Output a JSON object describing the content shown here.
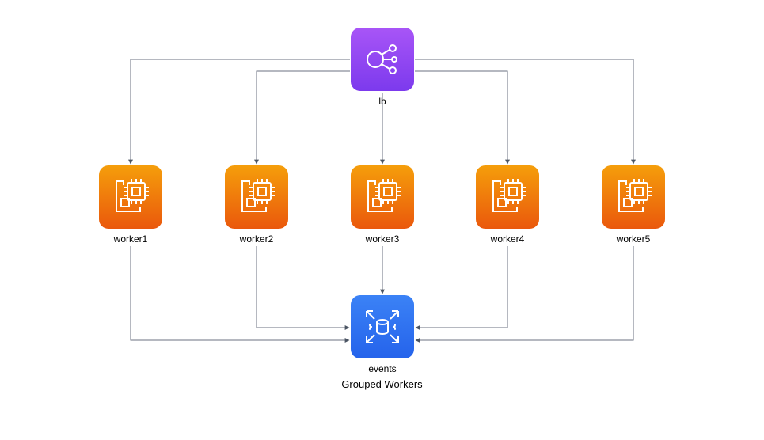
{
  "diagram_title": "Grouped Workers",
  "nodes": {
    "lb": {
      "label": "lb",
      "type": "load-balancer",
      "color": "#8b5cf6"
    },
    "worker1": {
      "label": "worker1",
      "type": "compute",
      "color": "#f97316"
    },
    "worker2": {
      "label": "worker2",
      "type": "compute",
      "color": "#f97316"
    },
    "worker3": {
      "label": "worker3",
      "type": "compute",
      "color": "#f97316"
    },
    "worker4": {
      "label": "worker4",
      "type": "compute",
      "color": "#f97316"
    },
    "worker5": {
      "label": "worker5",
      "type": "compute",
      "color": "#f97316"
    },
    "events": {
      "label": "events",
      "type": "database",
      "color": "#3b82f6"
    }
  },
  "edges": [
    {
      "from": "lb",
      "to": "worker1"
    },
    {
      "from": "lb",
      "to": "worker2"
    },
    {
      "from": "lb",
      "to": "worker3"
    },
    {
      "from": "lb",
      "to": "worker4"
    },
    {
      "from": "lb",
      "to": "worker5"
    },
    {
      "from": "worker1",
      "to": "events"
    },
    {
      "from": "worker2",
      "to": "events"
    },
    {
      "from": "worker3",
      "to": "events"
    },
    {
      "from": "worker4",
      "to": "events"
    },
    {
      "from": "worker5",
      "to": "events"
    }
  ],
  "colors": {
    "edge": "#6b7280",
    "arrow": "#4b5563"
  }
}
